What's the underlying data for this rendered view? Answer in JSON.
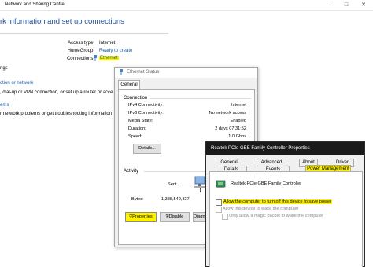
{
  "main_window": {
    "title": "Network and Sharing Centre",
    "controls": [
      "–",
      "□",
      "✕"
    ],
    "heading": "rk information and set up connections",
    "info": [
      {
        "label": "Access type:",
        "value": "Internet"
      },
      {
        "label": "HomeGroup:",
        "value": "Ready to create"
      },
      {
        "label": "Connections:",
        "value": "Ethernet"
      }
    ],
    "side_texts": [
      "ngs",
      "ction or network",
      ", dial-up or VPN connection, or set up a router or acce",
      "ems",
      "r network problems or get troubleshooting information"
    ]
  },
  "ethernet_status": {
    "title": "Ethernet Status",
    "tab": "General",
    "connection_label": "Connection",
    "rows": [
      {
        "label": "IPv4 Connectivity:",
        "value": "Internet"
      },
      {
        "label": "IPv6 Connectivity:",
        "value": "No network access"
      },
      {
        "label": "Media State:",
        "value": "Enabled"
      },
      {
        "label": "Duration:",
        "value": "2 days 07:31:52"
      },
      {
        "label": "Speed:",
        "value": "1.0 Gbps"
      }
    ],
    "details_button": "Details...",
    "activity_label": "Activity",
    "sent_label": "Sent",
    "bytes_label": "Bytes:",
    "bytes_sent": "1,388,549,827",
    "properties_button": "Properties",
    "disable_button": "Disable",
    "diagnose_button": "Diagnose"
  },
  "adapter_properties": {
    "title": "Realtek PCIe GBE Family Controller Properties",
    "tabs_row1": [
      "General",
      "Advanced",
      "About",
      "Driver"
    ],
    "tabs_row2": [
      "Details",
      "Events",
      "Power Management"
    ],
    "device_name": "Realtek PCIe GBE Family Controller",
    "options": [
      {
        "label": "Allow the computer to turn off this device to save power",
        "checked": false
      },
      {
        "label": "Allow this device to wake the computer",
        "checked": false
      },
      {
        "label": "Only allow a magic packet to wake the computer",
        "checked": false
      }
    ]
  },
  "colors": {
    "highlight": "#fff200",
    "link": "#1a5aa6",
    "heading": "#1f4e9c"
  }
}
